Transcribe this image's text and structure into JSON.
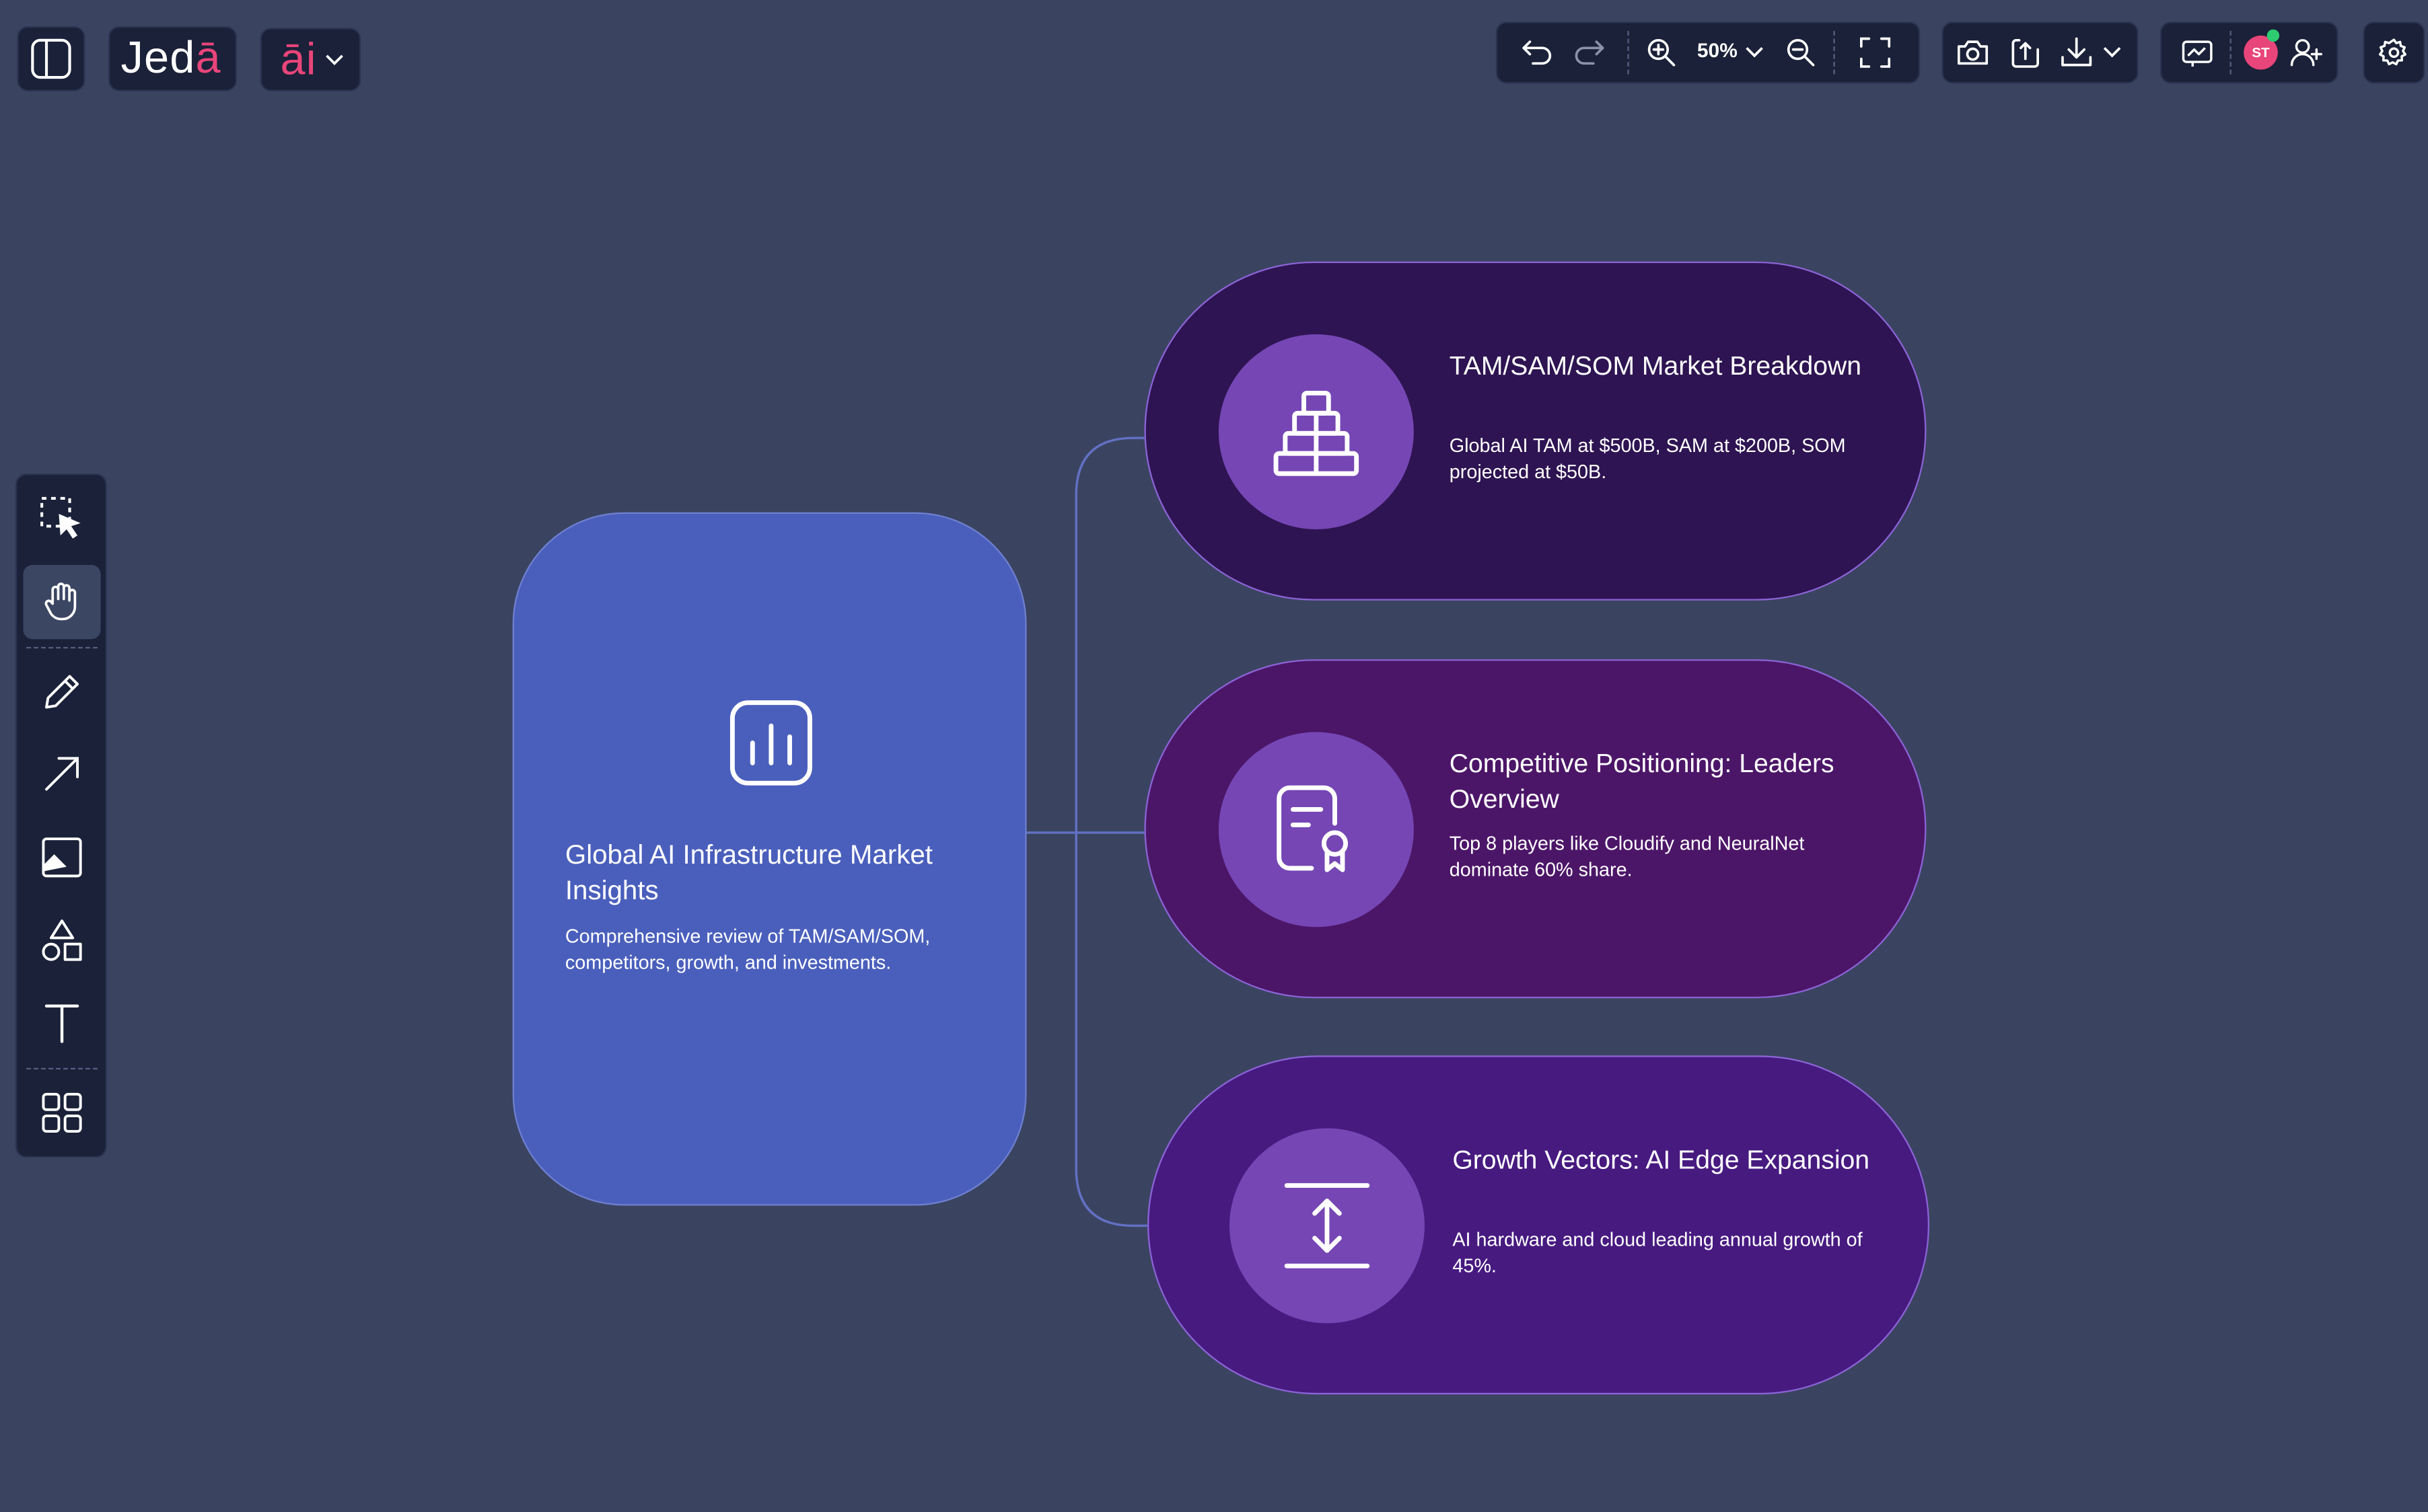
{
  "app": {
    "logo_main": "Jed",
    "logo_accent": "ā",
    "ai_label": "āi"
  },
  "toolbar": {
    "zoom_level": "50%",
    "user_initials": "ST"
  },
  "tools": [
    {
      "name": "select",
      "active": false
    },
    {
      "name": "hand",
      "active": true
    },
    {
      "name": "pencil",
      "active": false
    },
    {
      "name": "arrow",
      "active": false
    },
    {
      "name": "image",
      "active": false
    },
    {
      "name": "shapes",
      "active": false
    },
    {
      "name": "text",
      "active": false
    },
    {
      "name": "templates",
      "active": false
    }
  ],
  "canvas": {
    "main": {
      "title": "Global AI Infrastructure Market Insights",
      "description": "Comprehensive review of TAM/SAM/SOM, competitors, growth, and investments.",
      "icon": "bar-chart-icon",
      "color": "#4a5fbc"
    },
    "branches": [
      {
        "title": "TAM/SAM/SOM Market Breakdown",
        "description": "Global AI TAM at $500B, SAM at $200B, SOM projected at $50B.",
        "icon": "pyramid-icon",
        "color": "#2e1452"
      },
      {
        "title": "Competitive Positioning: Leaders Overview",
        "description": "Top 8 players like Cloudify and NeuralNet dominate 60% share.",
        "icon": "certificate-icon",
        "color": "#4c1668"
      },
      {
        "title": "Growth Vectors: AI Edge Expansion",
        "description": "AI hardware and cloud leading annual growth of 45%.",
        "icon": "expand-vertical-icon",
        "color": "#471a80"
      }
    ]
  },
  "colors": {
    "background": "#3a4460",
    "panel": "#1a2138",
    "accent": "#e8457a",
    "connector": "#6270c4"
  }
}
